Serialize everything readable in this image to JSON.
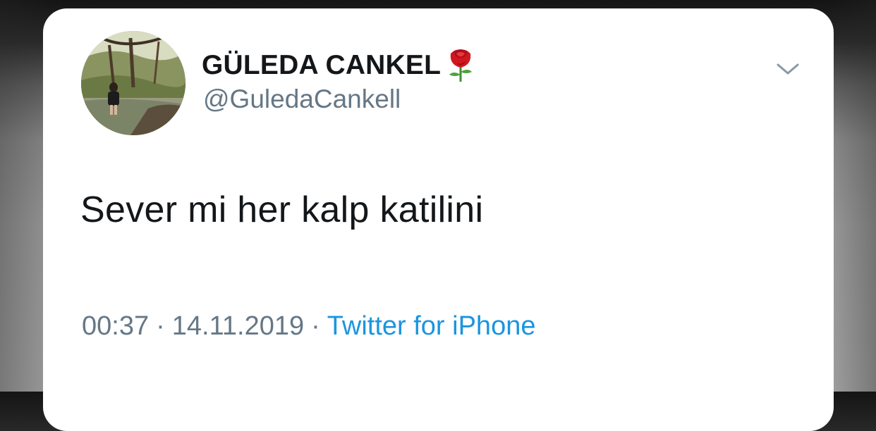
{
  "tweet": {
    "display_name": "GÜLEDA CANKEL",
    "handle": "@GuledaCankell",
    "text": "Sever mi her kalp katilini",
    "time": "00:37",
    "date": "14.11.2019",
    "separator": "·",
    "source": "Twitter for iPhone",
    "name_emoji": "rose-icon",
    "menu_icon": "chevron-down-icon"
  },
  "colors": {
    "name": "#14171a",
    "secondary_text": "#657786",
    "link": "#1b95e0",
    "card_background": "#ffffff"
  }
}
